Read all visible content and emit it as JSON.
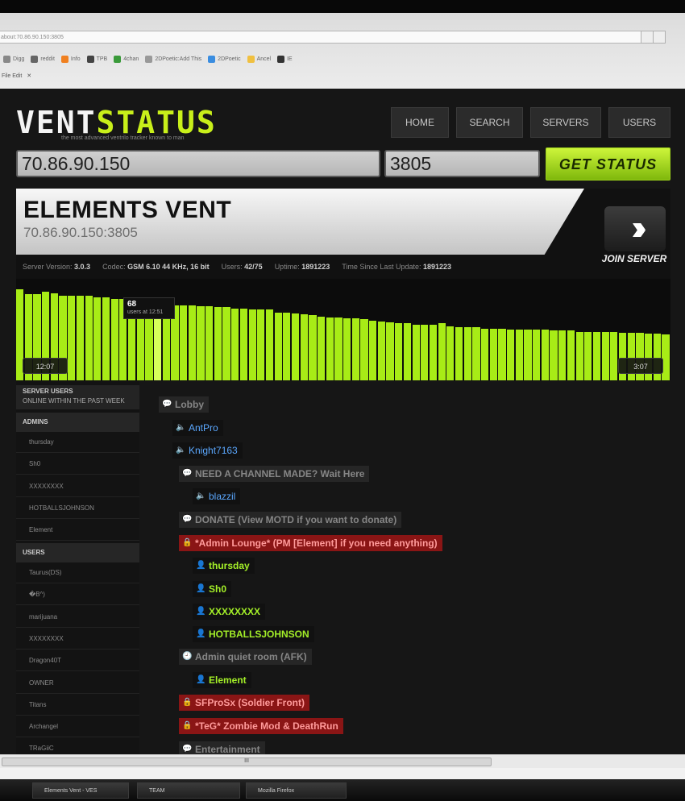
{
  "browser": {
    "address": "about:70.86.90.150:3805",
    "bookmarks": [
      {
        "label": "Digg",
        "color": "#888"
      },
      {
        "label": "reddit",
        "color": "#666"
      },
      {
        "label": "Info",
        "color": "#f08020"
      },
      {
        "label": "TPB",
        "color": "#444"
      },
      {
        "label": "4chan",
        "color": "#3a9a3a"
      },
      {
        "label": "2DPoetic:Add This",
        "color": "#999"
      },
      {
        "label": "2DPoetic",
        "color": "#3a8de0"
      },
      {
        "label": "Ancel",
        "color": "#f0c040"
      },
      {
        "label": "IE",
        "color": "#333"
      }
    ],
    "menu_text": "File  Edit"
  },
  "site": {
    "logo_vent": "VENT",
    "logo_status": "STATUS",
    "tagline": "the most advanced ventrilo tracker known to man",
    "nav": [
      "HOME",
      "SEARCH",
      "SERVERS",
      "USERS"
    ],
    "ip_value": "70.86.90.150",
    "port_value": "3805",
    "get_status": "GET STATUS"
  },
  "server": {
    "name": "ELEMENTS VENT",
    "address": "70.86.90.150:3805",
    "join_label": "JOIN SERVER",
    "join_icon": "double-chevron-right",
    "info": [
      {
        "label": "Server Version:",
        "value": "3.0.3"
      },
      {
        "label": "Codec:",
        "value": "GSM 6.10 44 KHz, 16 bit"
      },
      {
        "label": "Users:",
        "value": "42/75"
      },
      {
        "label": "Uptime:",
        "value": "1891223"
      },
      {
        "label": "Time Since Last Update:",
        "value": "1891223"
      }
    ]
  },
  "graph": {
    "bar_color": "#a8ec16",
    "max": 100,
    "values": [
      90,
      85,
      85,
      87,
      86,
      83,
      83,
      83,
      83,
      82,
      82,
      80,
      80,
      78,
      72,
      69,
      70,
      72,
      74,
      74,
      74,
      73,
      73,
      72,
      72,
      71,
      71,
      70,
      70,
      70,
      67,
      67,
      66,
      65,
      64,
      63,
      62,
      62,
      61,
      61,
      60,
      59,
      58,
      57,
      56,
      56,
      55,
      55,
      55,
      56,
      53,
      52,
      52,
      52,
      51,
      51,
      51,
      50,
      50,
      50,
      50,
      50,
      49,
      49,
      49,
      48,
      48,
      48,
      48,
      48,
      47,
      47,
      47,
      46,
      46,
      45
    ],
    "highlight_index": 16,
    "tooltip_value": "68",
    "tooltip_label": "users at 12:51",
    "start_time": "12:07",
    "end_time": "3:07"
  },
  "sidebar": {
    "title": "SERVER USERS",
    "subtitle": "ONLINE WITHIN THE PAST WEEK",
    "admins_label": "ADMINS",
    "admins": [
      "thursday",
      "Sh0",
      "XXXXXXXX",
      "HOTBALLSJOHNSON",
      "Element"
    ],
    "users_label": "USERS",
    "users": [
      "Taurus(DS)",
      "�B^)",
      "marijuana",
      "XXXXXXXX",
      "Dragon40T",
      "OWNER",
      "Titans",
      "Archangel",
      "TRaGiiC"
    ]
  },
  "tree": [
    {
      "text": "Lobby",
      "kind": "ch-grey",
      "icon": "chat-bubble-icon",
      "glyph": "💬",
      "indent": 0
    },
    {
      "text": "AntPro",
      "kind": "u-spk",
      "icon": "speaker-icon",
      "glyph": "🔈",
      "indent": 1
    },
    {
      "text": "Knight7163",
      "kind": "u-spk",
      "icon": "speaker-icon",
      "glyph": "🔈",
      "indent": 1
    },
    {
      "text": "NEED A CHANNEL MADE? Wait Here",
      "kind": "ch-grey",
      "icon": "chat-bubble-icon",
      "glyph": "💬",
      "indent": 2
    },
    {
      "text": "blazzil",
      "kind": "u-spk",
      "icon": "speaker-icon",
      "glyph": "🔈",
      "indent": 3
    },
    {
      "text": "DONATE (View MOTD if you want to donate)",
      "kind": "ch-grey",
      "icon": "chat-bubble-icon",
      "glyph": "💬",
      "indent": 2
    },
    {
      "text": "*Admin Lounge* (PM [Element] if you need anything)",
      "kind": "ch-red",
      "icon": "lock-icon",
      "glyph": "🔒",
      "indent": 2
    },
    {
      "text": "thursday",
      "kind": "u-grn",
      "icon": "user-icon",
      "glyph": "👤",
      "indent": 3
    },
    {
      "text": "Sh0",
      "kind": "u-grn",
      "icon": "user-icon",
      "glyph": "👤",
      "indent": 3
    },
    {
      "text": "XXXXXXXX",
      "kind": "u-grn",
      "icon": "user-icon",
      "glyph": "👤",
      "indent": 3
    },
    {
      "text": "HOTBALLSJOHNSON",
      "kind": "u-grn",
      "icon": "user-icon",
      "glyph": "👤",
      "indent": 3
    },
    {
      "text": "Admin quiet room (AFK)",
      "kind": "ch-grey",
      "icon": "clock-icon",
      "glyph": "🕘",
      "indent": 2
    },
    {
      "text": "Element",
      "kind": "u-grn",
      "icon": "user-icon",
      "glyph": "👤",
      "indent": 3
    },
    {
      "text": "SFProSx (Soldier Front)",
      "kind": "ch-red",
      "icon": "lock-icon",
      "glyph": "🔒",
      "indent": 2
    },
    {
      "text": "*TeG* Zombie Mod & DeathRun",
      "kind": "ch-red",
      "icon": "lock-icon",
      "glyph": "🔒",
      "indent": 2
    },
    {
      "text": "Entertainment",
      "kind": "ch-grey",
      "icon": "chat-bubble-icon",
      "glyph": "💬",
      "indent": 2
    }
  ],
  "bottom": {
    "scroll_grip": "III",
    "tasks": [
      "Elements Vent - VES",
      "TEAM",
      "Mozilla Firefox"
    ]
  }
}
